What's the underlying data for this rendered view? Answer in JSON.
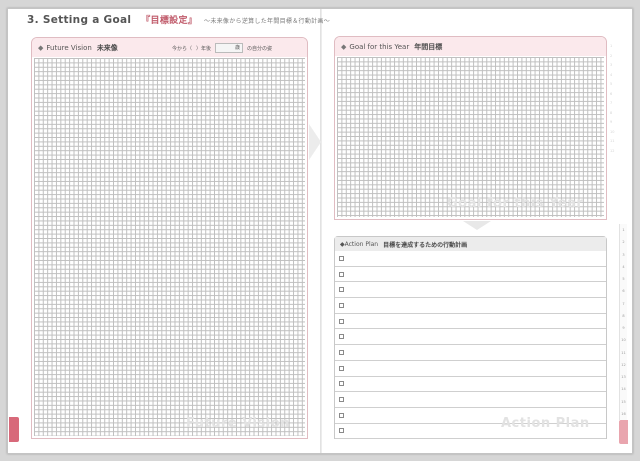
{
  "title": {
    "main": "3. Setting a Goal",
    "jp": "『目標設定』",
    "sub": "〜未来像から逆算した年間目標＆行動計画〜"
  },
  "vision": {
    "label": "Future Vision",
    "jp": "未来像",
    "meta_prefix": "今から（",
    "meta_year": "）年後",
    "meta_box": "歳",
    "meta_suffix": "の自分の姿",
    "watermark": "Future Vision"
  },
  "goal": {
    "label": "Goal for this Year",
    "jp": "年間目標",
    "watermark": "Goal for this Year"
  },
  "plan": {
    "label": "Action Plan",
    "jp": "目標を達成するための行動計画",
    "rows": 12,
    "watermark": "Action Plan"
  },
  "colors": {
    "accent": "#d8697a",
    "header_tint": "#fbe9ec",
    "grid": "#bfbfbf"
  }
}
